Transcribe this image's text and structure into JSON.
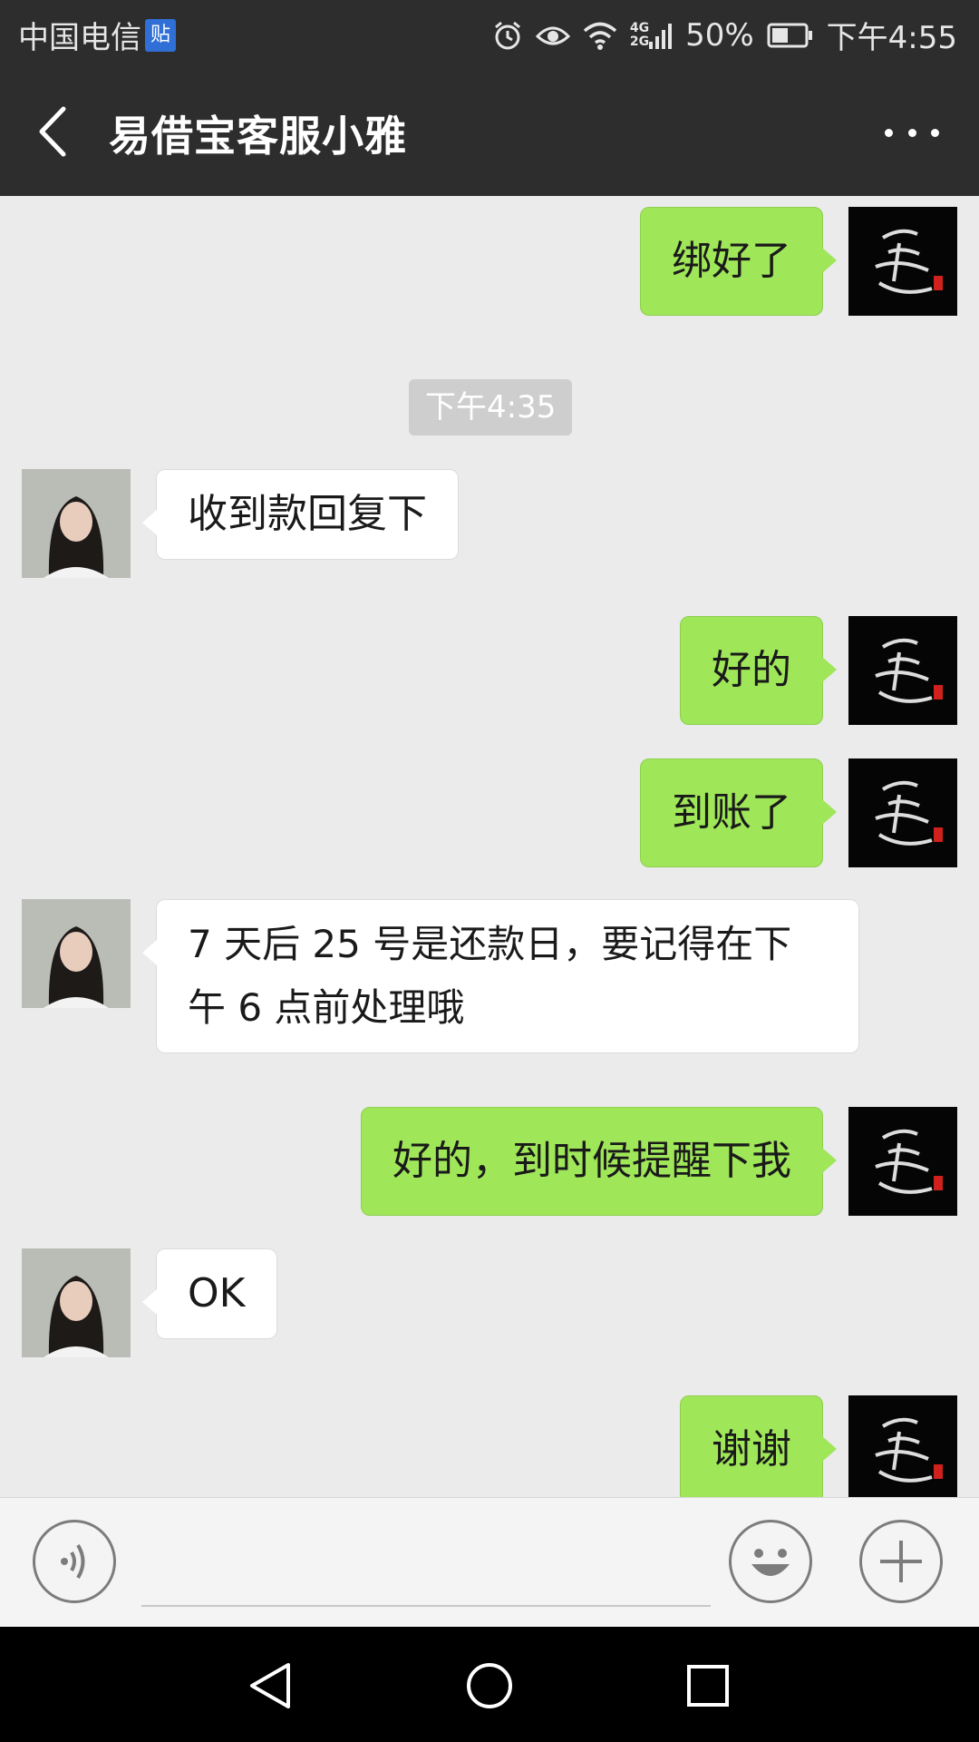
{
  "status_bar": {
    "carrier": "中国电信",
    "carrier_badge": "贴",
    "network": [
      "4G",
      "2G"
    ],
    "battery": "50%",
    "time": "下午4:55",
    "icons": [
      "alarm-icon",
      "eye-icon",
      "wifi-icon",
      "signal-icon",
      "battery-icon"
    ]
  },
  "header": {
    "title": "易借宝客服小雅",
    "icons": [
      "back-icon",
      "more-icon"
    ]
  },
  "messages": [
    {
      "sender": "me",
      "text": "绑好了"
    },
    {
      "timestamp": "下午4:35"
    },
    {
      "sender": "other",
      "text": "收到款回复下"
    },
    {
      "sender": "me",
      "text": "好的"
    },
    {
      "sender": "me",
      "text": "到账了"
    },
    {
      "sender": "other",
      "lines": [
        "7 天后 25 号是还款日，要记得在下",
        "午 6 点前处理哦"
      ]
    },
    {
      "sender": "me",
      "text": "好的，到时候提醒下我"
    },
    {
      "sender": "other",
      "text": "OK"
    },
    {
      "sender": "me",
      "text": "谢谢"
    }
  ],
  "input_bar": {
    "placeholder": "",
    "icons": [
      "voice-icon",
      "emoji-icon",
      "plus-icon"
    ]
  },
  "navigation_bar": {
    "icons": [
      "nav-back-icon",
      "nav-home-icon",
      "nav-recents-icon"
    ]
  },
  "colors": {
    "title_bar": "#2d2d2d",
    "chat_background": "#ebebeb",
    "my_bubble": "#9fe659",
    "other_bubble": "#ffffff",
    "timestamp_background": "#cecece",
    "carrier_badge": "#2f6fd6"
  }
}
